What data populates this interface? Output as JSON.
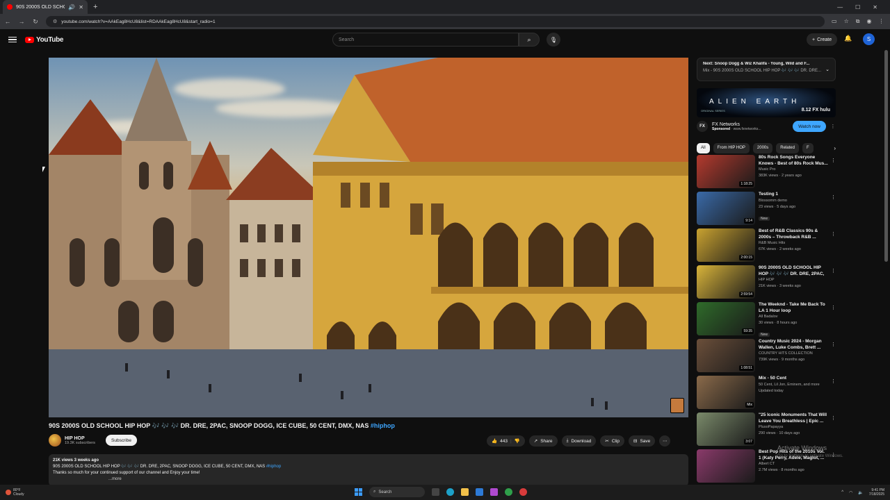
{
  "browser": {
    "tab_title": "90S 2000S OLD SCHOOL H",
    "url": "youtube.com/watch?v=AAkEag8HcU8&list=RDAAkEag8HcU8&start_radio=1"
  },
  "youtube": {
    "logo_text": "YouTube",
    "search_placeholder": "Search",
    "create_label": "Create",
    "account_initial": "S"
  },
  "video": {
    "title": "90S 2000S OLD SCHOOL HIP HOP 🎶 🎶 🎶 DR. DRE, 2PAC, SNOOP DOGG, ICE CUBE, 50 CENT, DMX, NAS ",
    "hashtag": "#hiphop",
    "channel_name": "HIP HOP",
    "subscribers": "19.3K subscribers",
    "subscribe_label": "Subscribe",
    "likes": "443",
    "share_label": "Share",
    "download_label": "Download",
    "clip_label": "Clip",
    "save_label": "Save",
    "desc_meta": "21K views  3 weeks ago",
    "desc_line1": "90S 2000S OLD SCHOOL HIP HOP 🎶 🎶 🎶 DR. DRE, 2PAC, SNOOP DOGG, ICE CUBE, 50 CENT, DMX, NAS ",
    "desc_hashtag": "#hiphop",
    "desc_line2": "Thanks so much for your continued support of our channel and Enjoy your time!",
    "desc_more": "...more"
  },
  "sidebar": {
    "next_up": "Next: Snoop Dogg & Wiz Khalifa - Young, Wild and F...",
    "next_up_sub": "Mix - 90S 2000S OLD SCHOOL HIP HOP 🎶 🎶 🎶 DR. DRE...",
    "ad": {
      "banner_text": "ALIEN EARTH",
      "fx_text": "8.12 FX hulu",
      "series_text": "ORIGINAL SERIES",
      "advertiser": "FX Networks",
      "sponsored": "Sponsored",
      "domain": " · www.fxnetworks...",
      "logo_text": "FX",
      "watch_label": "Watch now"
    },
    "chips": [
      "All",
      "From HIP HOP",
      "2000s",
      "Related",
      "F"
    ],
    "videos": [
      {
        "title": "80s Rock Songs Everyone Knows - Best of 80s Rock Mus...",
        "channel": "Music Pro",
        "meta": "383K views · 2 years ago",
        "duration": "1:18:25",
        "badge": "",
        "color": "#b43a2e"
      },
      {
        "title": "Testing 1",
        "channel": "Blossomm demo",
        "meta": "23 views · 5 days ago",
        "duration": "9:14",
        "badge": "New",
        "color": "#3a6aa8"
      },
      {
        "title": "Best of R&B Classics 90s & 2000s – Throwback R&B ...",
        "channel": "R&B Music Hits",
        "meta": "67K views · 2 weeks ago",
        "duration": "2:00:15",
        "badge": "",
        "color": "#c9a230"
      },
      {
        "title": "90S 2000S OLD SCHOOL HIP HOP 🎶 🎶 🎶 DR. DRE, 2PAC, ...",
        "channel": "HIP HOP",
        "meta": "21K views · 3 weeks ago",
        "duration": "2:59:54",
        "badge": "",
        "color": "#d9b43a"
      },
      {
        "title": "The Weeknd - Take Me Back To LA 1 Hour loop",
        "channel": "All Badalov",
        "meta": "30 views · 8 hours ago",
        "duration": "59:35",
        "badge": "New",
        "color": "#2f6b2a"
      },
      {
        "title": "Country Music 2024 - Morgan Wallen, Luke Combs, Brett ...",
        "channel": "COUNTRY HITS COLLECTION",
        "meta": "739K views · 9 months ago",
        "duration": "1:08:51",
        "badge": "",
        "color": "#6b4f3a"
      },
      {
        "title": "Mix - 50 Cent",
        "channel": "50 Cent, Lil Jon, Eminem, and more",
        "meta": "Updated today",
        "duration": "Mix",
        "badge": "",
        "color": "#8a6a4a"
      },
      {
        "title": "\"25 Iconic Monuments That Will Leave You Breathless | Epic ...",
        "channel": "PlusoPapayya",
        "meta": "290 views · 10 days ago",
        "duration": "3:07",
        "badge": "",
        "color": "#7a8a6a"
      },
      {
        "title": "Best Pop Hits of the 2010s Vol. 1 (Katy Perry, Adele, Maglot, ...",
        "channel": "Albert CT",
        "meta": "2.7M views · 8 months ago",
        "duration": "",
        "badge": "",
        "color": "#8a3a6a"
      }
    ]
  },
  "overlay": {
    "activate_title": "Activate Windows",
    "activate_sub": "Go to Settings to activate Windows."
  },
  "taskbar": {
    "weather_temp": "80°F",
    "weather_desc": "Cloudy",
    "search_label": "Search",
    "time": "9:41 PM",
    "date": "7/18/2025"
  }
}
